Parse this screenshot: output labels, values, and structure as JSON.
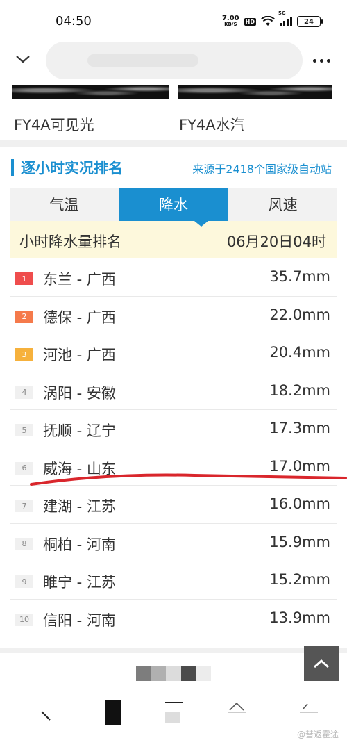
{
  "status_bar": {
    "time": "04:50",
    "net_speed_value": "7.00",
    "net_speed_unit": "KB/S",
    "hd_label": "HD",
    "signal_label": "5G",
    "battery": "24"
  },
  "icons": {
    "back": "chevron-down-icon",
    "more": "more-dots-icon",
    "scroll_top": "chevron-up-icon"
  },
  "thumbs": [
    {
      "label": "FY4A可见光"
    },
    {
      "label": "FY4A水汽"
    }
  ],
  "ranking": {
    "title": "逐小时实况排名",
    "source": "来源于2418个国家级自动站",
    "tabs": [
      {
        "label": "气温",
        "active": false
      },
      {
        "label": "降水",
        "active": true
      },
      {
        "label": "风速",
        "active": false
      }
    ],
    "subheader_title": "小时降水量排名",
    "subheader_time": "06月20日04时",
    "rows": [
      {
        "rank": "1",
        "place": "东兰 - 广西",
        "value": "35.7mm"
      },
      {
        "rank": "2",
        "place": "德保 - 广西",
        "value": "22.0mm"
      },
      {
        "rank": "3",
        "place": "河池 - 广西",
        "value": "20.4mm"
      },
      {
        "rank": "4",
        "place": "涡阳 - 安徽",
        "value": "18.2mm"
      },
      {
        "rank": "5",
        "place": "抚顺 - 辽宁",
        "value": "17.3mm"
      },
      {
        "rank": "6",
        "place": "威海 - 山东",
        "value": "17.0mm"
      },
      {
        "rank": "7",
        "place": "建湖 - 江苏",
        "value": "16.0mm"
      },
      {
        "rank": "8",
        "place": "桐柏 - 河南",
        "value": "15.9mm"
      },
      {
        "rank": "9",
        "place": "睢宁 - 江苏",
        "value": "15.2mm"
      },
      {
        "rank": "10",
        "place": "信阳 - 河南",
        "value": "13.9mm"
      }
    ]
  },
  "colors": {
    "accent": "#1a8fd0",
    "rank1": "#ef4d4d",
    "rank2": "#f57a4b",
    "rank3": "#f6b13c",
    "subheader_bg": "#fdf8dc",
    "annotation": "#d9262c"
  },
  "watermark": "@彗返霍途"
}
